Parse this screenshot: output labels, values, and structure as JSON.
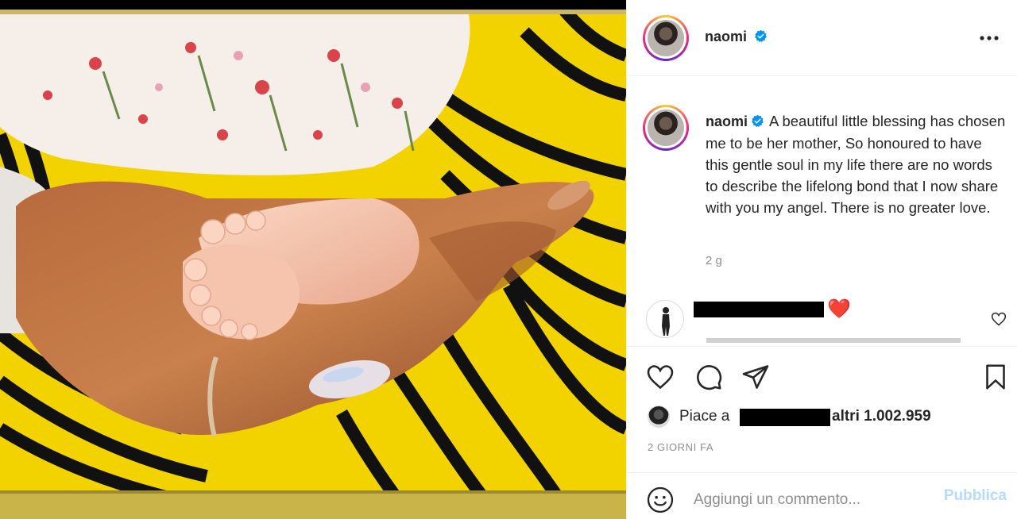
{
  "post": {
    "username": "naomi",
    "verified": true,
    "more_icon": "more-options-icon",
    "image_alt_icon": "baby-feet-photo"
  },
  "caption": {
    "username": "naomi",
    "text": "A beautiful little blessing has chosen me to be her mother, So honoured to have this gentle soul in my life there are no words to describe the lifelong bond that I now share with you my angel. There is no greater love.",
    "time_ago": "2 g"
  },
  "comment": {
    "emoji": "❤️",
    "like_icon": "heart-outline-icon"
  },
  "actions": {
    "like_icon": "heart-icon",
    "comment_icon": "comment-icon",
    "share_icon": "paper-plane-icon",
    "save_icon": "bookmark-icon"
  },
  "likes": {
    "prefix": "Piace a",
    "suffix": "altri 1.002.959"
  },
  "date_label": "2 GIORNI FA",
  "add_comment": {
    "placeholder": "Aggiungi un commento...",
    "publish_label": "Pubblica",
    "emoji_icon": "smiley-icon"
  },
  "colors": {
    "accent_blue": "#0095f6",
    "publish_disabled": "#b3dbff",
    "heart_red": "#e0101a",
    "text_primary": "#262626",
    "text_secondary": "#8e8e8e"
  }
}
